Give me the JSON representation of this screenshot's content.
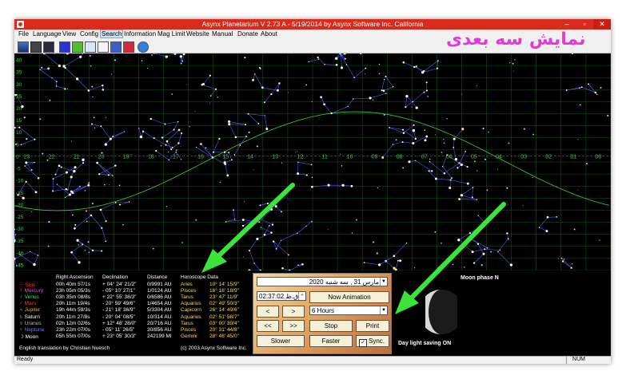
{
  "window": {
    "title": "Asynx Planetarium V 2.73 A - 5/19/2014 by Asynx Software Inc. California",
    "buttons": {
      "minimize": "–",
      "maximize": "▫",
      "close": "✕"
    }
  },
  "menu": [
    "File",
    "Language",
    "View",
    "Config",
    "Search",
    "Information",
    "Mag Limit",
    "Website",
    "Manual",
    "Donate",
    "About"
  ],
  "menu_active": "Search",
  "overlay_caption": "نمایش سه بعدی",
  "toolbar_icons": [
    "sky-view-icon",
    "chart-icon",
    "film-icon",
    "m-icon",
    "s-icon",
    "page-icon",
    "copy-icon",
    "calendar-icon",
    "flag-icon",
    "help-icon"
  ],
  "sky": {
    "ra_labels": [
      "23",
      "22",
      "21",
      "20",
      "19",
      "18",
      "17",
      "16",
      "15",
      "14",
      "13",
      "12",
      "11",
      "10",
      "09",
      "08",
      "07",
      "06",
      "05",
      "04",
      "03",
      "02",
      "01",
      "00"
    ],
    "dec_labels": [
      "40",
      "35",
      "30",
      "25",
      "20",
      "15",
      "10",
      "5",
      "0",
      "-5",
      "-10",
      "-15",
      "-20",
      "-25",
      "-30",
      "-35",
      "-40",
      "-45"
    ]
  },
  "table": {
    "headers": [
      "",
      "Right Ascension",
      "Declination",
      "Distance",
      "Horoscope Data"
    ],
    "rows": [
      {
        "symbol": "☉",
        "name": "Sun",
        "ra": "00h 40m 57/1s",
        "dec": "+ 04° 24' 21/2\"",
        "dist": "0/9991 AU",
        "sign": "Aries",
        "deg": "10° 14' 15/9\"",
        "color": "#ff3b2a"
      },
      {
        "symbol": "☿",
        "name": "Mercury",
        "ra": "23h 05m 05/3s",
        "dec": "- 05° 10' 27/1\"",
        "dist": "1/0124 AU",
        "sign": "Pisces",
        "deg": "16° 16' 18/9\"",
        "color": "#ff3bd0"
      },
      {
        "symbol": "♀",
        "name": "Venus",
        "ra": "03h 35m 08/8s",
        "dec": "+ 22° 55' 38/3\"",
        "dist": "0/6586 AU",
        "sign": "Tarus",
        "deg": "23° 47' 11/9\"",
        "color": "#2ee83a"
      },
      {
        "symbol": "♂",
        "name": "Mars",
        "ra": "20h 11m 19/4s",
        "dec": "- 20° 59' 49/6\"",
        "dist": "1/4654 AU",
        "sign": "Aquarius",
        "deg": "02° 49' 50/3\"",
        "color": "#ff3b2a"
      },
      {
        "symbol": "♃",
        "name": "Jupiter",
        "ra": "19h 44m 59/3s",
        "dec": "- 21° 18' 36/9\"",
        "dist": "5/3304 AU",
        "sign": "Capicorn",
        "deg": "26° 14' 49/6\"",
        "color": "#ff9f30"
      },
      {
        "symbol": "♄",
        "name": "Saturn",
        "ra": "20h 11m 27/8s",
        "dec": "- 20° 04' 08/5\"",
        "dist": "10/314 AU",
        "sign": "Aquarius",
        "deg": "02° 51' 58/7\"",
        "color": "#ffffff"
      },
      {
        "symbol": "♅",
        "name": "Uranus",
        "ra": "02h 12m 02/6s",
        "dec": "+ 12° 48' 28/0\"",
        "dist": "20/716 AU",
        "sign": "Tarus",
        "deg": "03° 00' 39/4\"",
        "color": "#b8b8b8"
      },
      {
        "symbol": "♆",
        "name": "Neptune",
        "ra": "23h 22m 07/0s",
        "dec": "- 05° 11' 26/5\"",
        "dist": "30/856 AU",
        "sign": "Pisces",
        "deg": "20° 31' 44/8\"",
        "color": "#6a7dff"
      },
      {
        "symbol": "☽",
        "name": "Moon",
        "ra": "05h 55m 07/0s",
        "dec": "+ 23° 05' 30/3\"",
        "dist": "242199 MI",
        "sign": "Gemini",
        "deg": "28° 46' 45/0\"",
        "color": "#ffffff"
      }
    ],
    "footer_left": "English translation by Christian Nuesch",
    "footer_right": "(c) 2003 Asynx Software Inc."
  },
  "controls": {
    "date": "2020  مارس  31 , سه شنبه",
    "time": "02:37:02 ق.ظ",
    "now_animation": "Now Animation",
    "step_back": "<",
    "step_fwd": ">",
    "interval": "6 Hours",
    "fast_back": "<<",
    "fast_fwd": ">>",
    "stop": "Stop",
    "print": "Print",
    "slower": "Slower",
    "faster": "Faster",
    "sync": "Sync.",
    "sync_checked": true
  },
  "moon": {
    "phase_label": "Moon phase  N",
    "dst": "Day light saving ON"
  },
  "status": {
    "left": "Ready",
    "num": "NUM"
  },
  "colors": {
    "title_bar": "#d92a1c",
    "overlay_text": "#e23ad6",
    "arrow": "#3be33a",
    "grid": "#1f5a1f",
    "ecliptic": "#3ecf3e",
    "constellation": "#4a5cff"
  }
}
